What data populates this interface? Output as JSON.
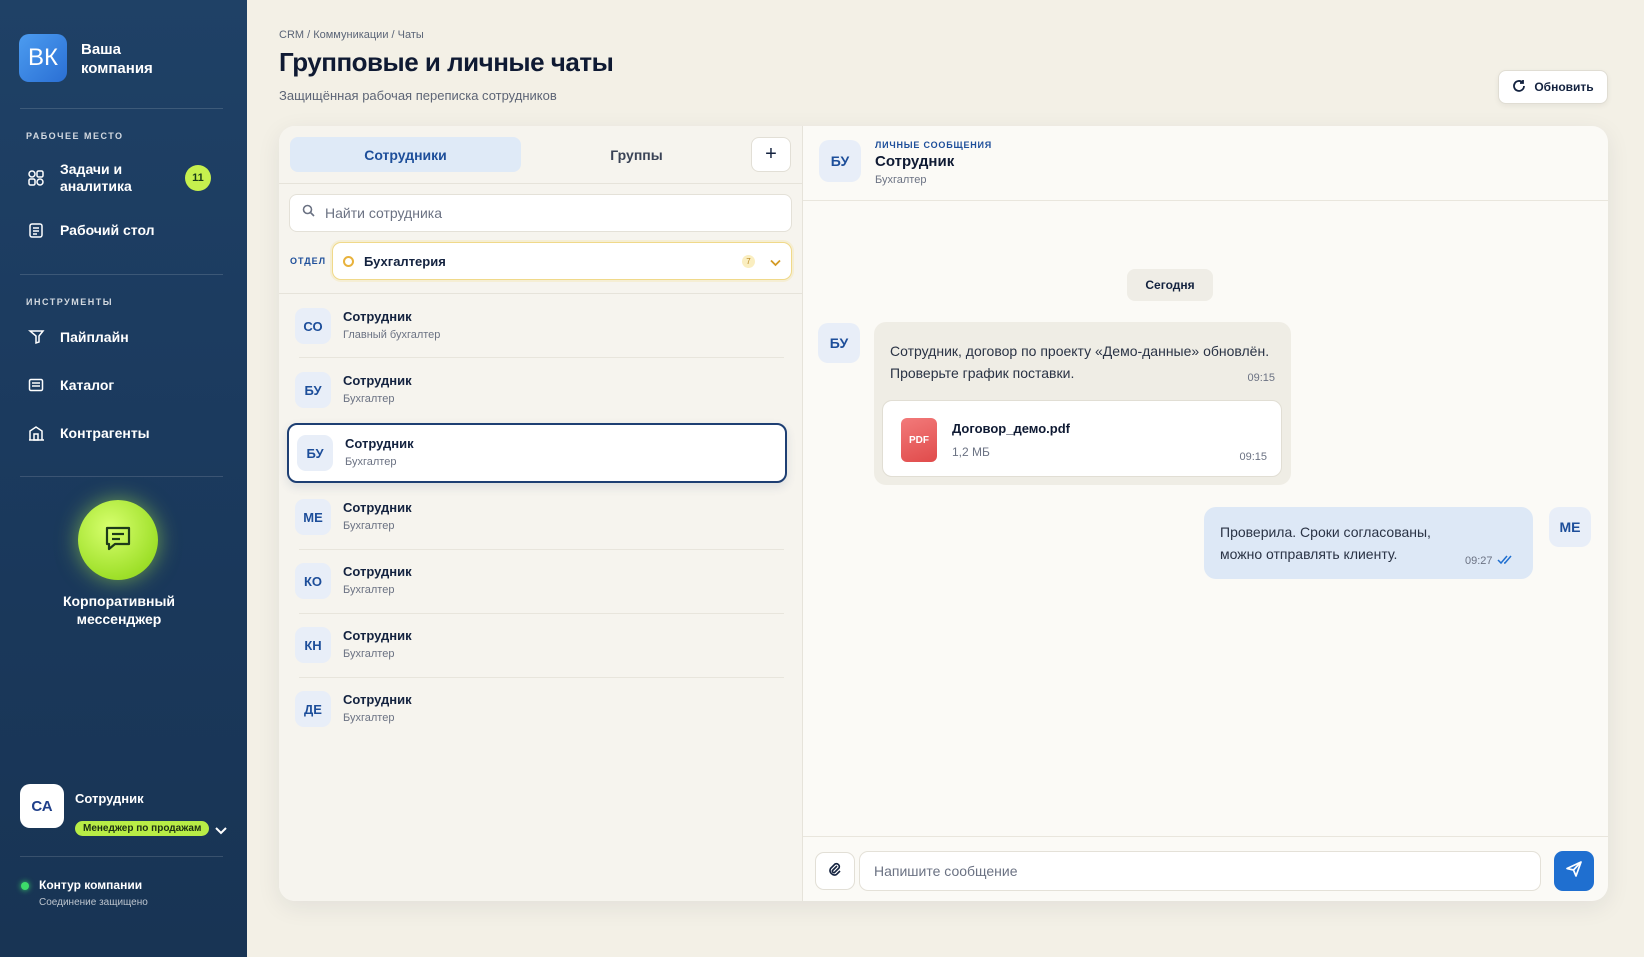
{
  "sidebar": {
    "logo_initials": "ВК",
    "company_line1": "Ваша",
    "company_line2": "компания",
    "section_workspace": "Рабочее место",
    "items_workspace": [
      {
        "label_line1": "Задачи и",
        "label_line2": "аналитика",
        "badge": "11",
        "icon": "tasks-analytics-icon"
      },
      {
        "label_line1": "Рабочий стол",
        "icon": "desktop-icon"
      }
    ],
    "section_tools": "Инструменты",
    "items_tools": [
      {
        "label": "Пайплайн",
        "icon": "pipeline-icon"
      },
      {
        "label": "Каталог",
        "icon": "catalog-icon"
      },
      {
        "label": "Контрагенты",
        "icon": "counterparties-icon"
      }
    ],
    "messenger_line1": "Корпоративный",
    "messenger_line2": "мессенджер",
    "user": {
      "initials": "СА",
      "name": "Сотрудник",
      "role": "Менеджер по продажам"
    },
    "status": {
      "title": "Контур компании",
      "subtitle": "Соединение защищено"
    }
  },
  "header": {
    "breadcrumb": "CRM / Коммуникации / Чаты",
    "title": "Групповые и личные чаты",
    "subtitle": "Защищённая рабочая переписка сотрудников",
    "refresh_label": "Обновить"
  },
  "tabs": {
    "employees": "Сотрудники",
    "groups": "Группы",
    "add": "+"
  },
  "search": {
    "placeholder": "Найти сотрудника",
    "value": ""
  },
  "department": {
    "label": "Отдел",
    "value": "Бухгалтерия",
    "count": "7"
  },
  "employees": [
    {
      "initials": "СО",
      "name": "Сотрудник",
      "role": "Главный бухгалтер"
    },
    {
      "initials": "БУ",
      "name": "Сотрудник",
      "role": "Бухгалтер"
    },
    {
      "initials": "БУ",
      "name": "Сотрудник",
      "role": "Бухгалтер",
      "selected": true
    },
    {
      "initials": "МЕ",
      "name": "Сотрудник",
      "role": "Бухгалтер"
    },
    {
      "initials": "КО",
      "name": "Сотрудник",
      "role": "Бухгалтер"
    },
    {
      "initials": "КН",
      "name": "Сотрудник",
      "role": "Бухгалтер"
    },
    {
      "initials": "ДЕ",
      "name": "Сотрудник",
      "role": "Бухгалтер"
    }
  ],
  "chat": {
    "kicker": "Личные сообщения",
    "initials": "БУ",
    "name": "Сотрудник",
    "role": "Бухгалтер",
    "day": "Сегодня",
    "incoming": {
      "initials": "БУ",
      "line1": "Сотрудник, договор по проекту «Демо-данные» обновлён.",
      "line2": "Проверьте график поставки.",
      "time": "09:15",
      "file": {
        "name": "Договор_демо.pdf",
        "size": "1,2 МБ",
        "badge": "PDF",
        "time": "09:15"
      }
    },
    "outgoing": {
      "initials": "МЕ",
      "line1": "Проверила. Сроки согласованы,",
      "line2": "можно отправлять клиенту.",
      "time": "09:27"
    },
    "composer_placeholder": "Напишите сообщение"
  },
  "colors": {
    "accent": "#1f6fd0",
    "lime": "#b8ed46",
    "sidebar": "#1b3a5e",
    "selected_border": "#1e3f73"
  }
}
